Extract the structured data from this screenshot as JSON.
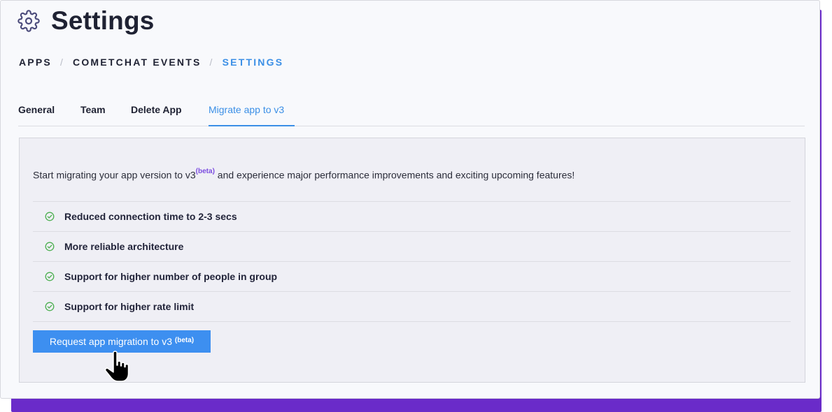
{
  "page": {
    "title": "Settings",
    "title_icon": "gear-icon"
  },
  "breadcrumb": {
    "items": [
      "APPS",
      "COMETCHAT EVENTS",
      "SETTINGS"
    ],
    "separator": "/"
  },
  "tabs": [
    {
      "label": "General",
      "active": false
    },
    {
      "label": "Team",
      "active": false
    },
    {
      "label": "Delete App",
      "active": false
    },
    {
      "label": "Migrate app to v3",
      "active": true
    }
  ],
  "migration": {
    "intro_before": "Start migrating your app version to v3",
    "intro_badge": "(beta)",
    "intro_after": " and experience major performance improvements and exciting upcoming features!",
    "features": [
      {
        "label": "Reduced connection time to 2-3 secs",
        "icon": "check-circle-icon"
      },
      {
        "label": "More reliable architecture",
        "icon": "check-circle-icon"
      },
      {
        "label": "Support for higher number of people in group",
        "icon": "check-circle-icon"
      },
      {
        "label": "Support for higher rate limit",
        "icon": "check-circle-icon"
      }
    ],
    "button_label": "Request app migration to v3 ",
    "button_badge": "(beta)"
  },
  "colors": {
    "accent": "#3b8fe6",
    "button": "#3d8ff0",
    "check": "#4caf50",
    "badge": "#7b4ce0",
    "frame": "#6a2bc9"
  }
}
